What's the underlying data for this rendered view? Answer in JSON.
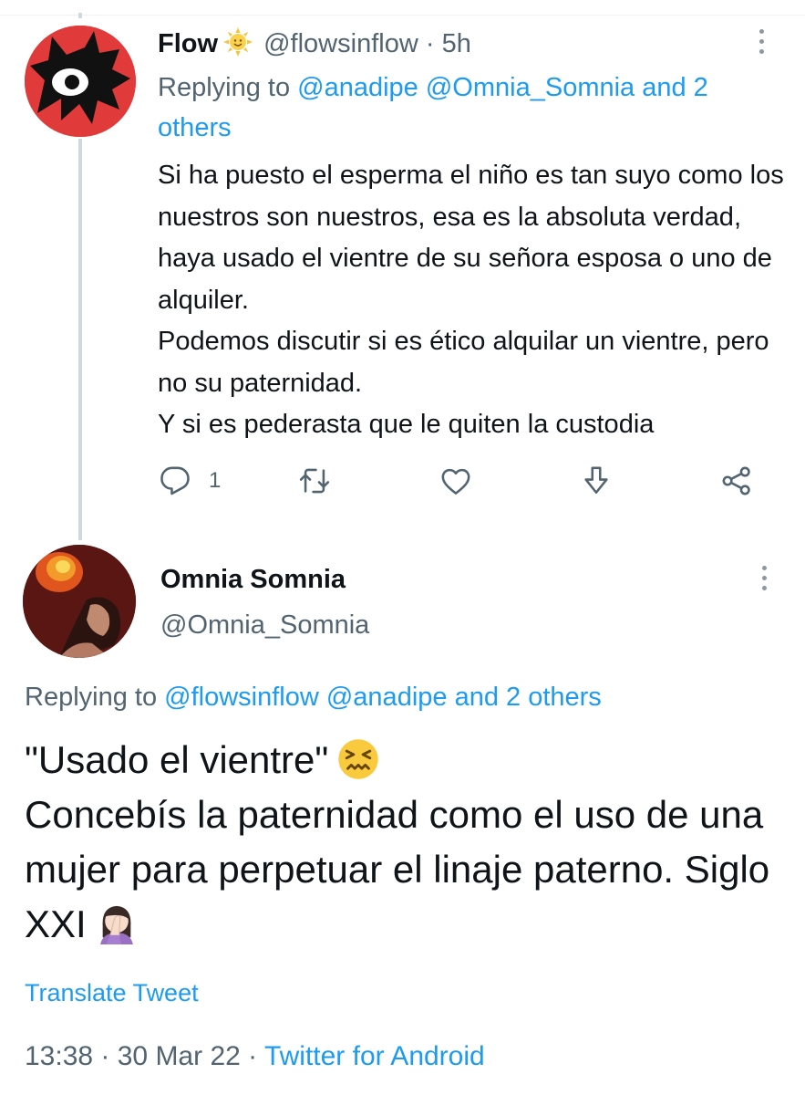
{
  "tweet1": {
    "display_name": "Flow",
    "name_emoji": "sun-emoji",
    "handle": "@flowsinflow",
    "separator": "·",
    "time": "5h",
    "replying_prefix": "Replying to",
    "replying_mentions": "@anadipe @Omnia_Somnia and 2 others",
    "body_lines": [
      "Si ha puesto el esperma el niño es tan suyo como los nuestros son nuestros, esa es la absoluta verdad, haya usado el vientre de su señora esposa o uno de alquiler.",
      "Podemos discutir si es ético alquilar un vientre, pero no su paternidad.",
      "Y si es pederasta que le quiten la custodia"
    ],
    "reply_count": "1",
    "icons": {
      "reply": "reply-icon",
      "retweet": "retweet-icon",
      "like": "like-icon",
      "download": "download-icon",
      "share": "share-icon",
      "more": "more-icon"
    }
  },
  "tweet2": {
    "display_name": "Omnia Somnia",
    "handle": "@Omnia_Somnia",
    "replying_prefix": "Replying to",
    "replying_mentions": "@flowsinflow @anadipe and 2 others",
    "quote_text": "\"Usado el vientre\"",
    "quote_emoji": "confounded-face-emoji",
    "body_text": "Concebís la paternidad como el uso de una mujer para perpetuar el linaje paterno. Siglo XXI",
    "body_emoji": "woman-facepalming-emoji",
    "translate_label": "Translate Tweet",
    "timestamp": "13:38 · 30 Mar 22 ·",
    "source": "Twitter for Android"
  },
  "colors": {
    "text": "#0f1419",
    "muted": "#536471",
    "link": "#1d9bf0",
    "thread_line": "#cfd9de",
    "avatar1_bg": "#e03a3a"
  }
}
